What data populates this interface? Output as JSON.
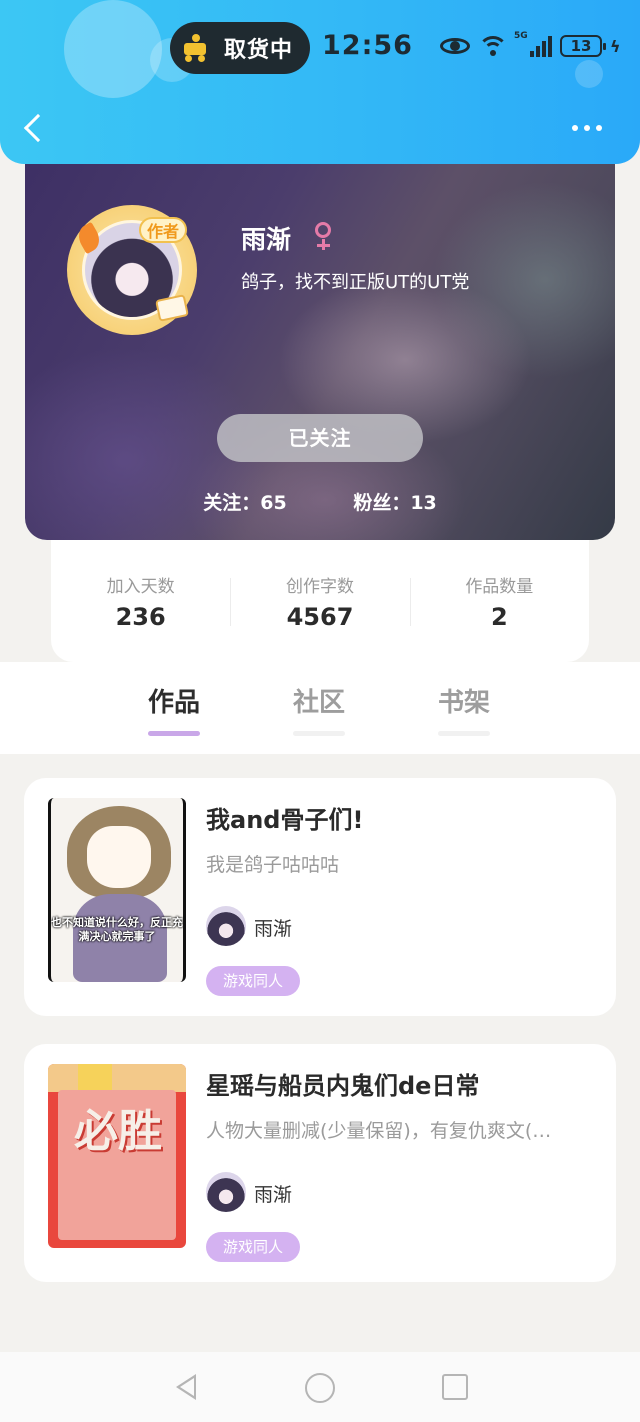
{
  "status_bar": {
    "pill_text": "取货中",
    "time": "12:56",
    "network": "5G",
    "battery": "13"
  },
  "header": {
    "back_icon": "chevron-left-icon",
    "more_icon": "more-dots-icon"
  },
  "profile": {
    "avatar_badge": "作者",
    "name": "雨渐",
    "gender_icon": "female-icon",
    "bio": "鸽子，找不到正版UT的UT党",
    "follow_button": "已关注",
    "following_label": "关注：65",
    "followers_label": "粉丝：13"
  },
  "stats": [
    {
      "label": "加入天数",
      "value": "236"
    },
    {
      "label": "创作字数",
      "value": "4567"
    },
    {
      "label": "作品数量",
      "value": "2"
    }
  ],
  "tabs": [
    {
      "label": "作品",
      "active": true
    },
    {
      "label": "社区",
      "active": false
    },
    {
      "label": "书架",
      "active": false
    }
  ],
  "works": [
    {
      "title": "我and骨子们!",
      "desc": "我是鸽子咕咕咕",
      "author": "雨渐",
      "tag": "游戏同人",
      "cover_caption": "也不知道说什么好，反正充满决心就完事了"
    },
    {
      "title": "星瑶与船员内鬼们de日常",
      "desc": "人物大量删减(少量保留)，有复仇爽文(…",
      "author": "雨渐",
      "tag": "游戏同人",
      "cover_caption": "必胜"
    }
  ],
  "colors": {
    "header_blue": "#33b8f6",
    "tab_accent": "#c9a7e8",
    "tag_purple": "#d4b2f1",
    "gender_pink": "#e57ba8"
  }
}
